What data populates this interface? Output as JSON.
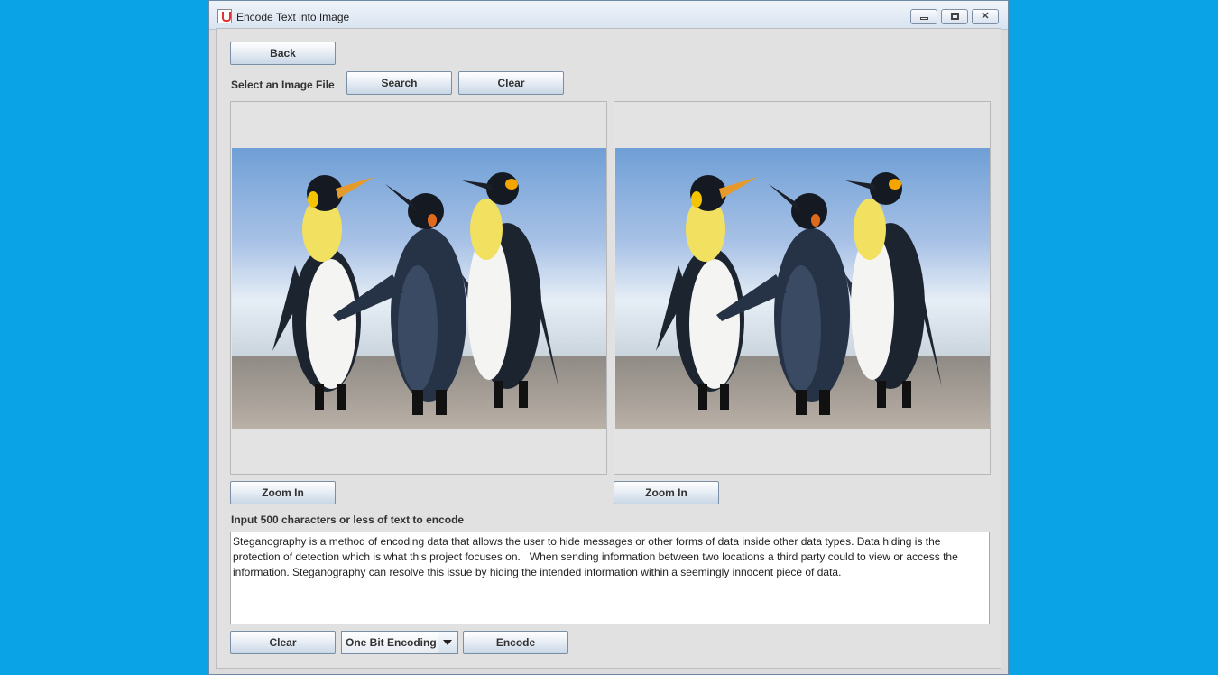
{
  "window": {
    "title": "Encode Text into Image"
  },
  "toolbar": {
    "back_label": "Back",
    "select_label": "Select an Image File",
    "search_label": "Search",
    "clear_label": "Clear"
  },
  "panels": {
    "left_zoom_label": "Zoom In",
    "right_zoom_label": "Zoom In"
  },
  "input": {
    "prompt": "Input 500 characters or less of text to encode",
    "value": "Steganography is a method of encoding data that allows the user to hide messages or other forms of data inside other data types. Data hiding is the protection of detection which is what this project focuses on.   When sending information between two locations a third party could to view or access the information. Steganography can resolve this issue by hiding the intended information within a seemingly innocent piece of data."
  },
  "bottom": {
    "clear_label": "Clear",
    "encoding_selected": "One Bit Encoding",
    "encode_label": "Encode"
  },
  "colors": {
    "desktop": "#0aa3e6",
    "window_bg": "#dcdcdc"
  },
  "icons": [
    "java-app-icon",
    "minimize-icon",
    "maximize-icon",
    "close-icon",
    "chevron-down-icon"
  ]
}
